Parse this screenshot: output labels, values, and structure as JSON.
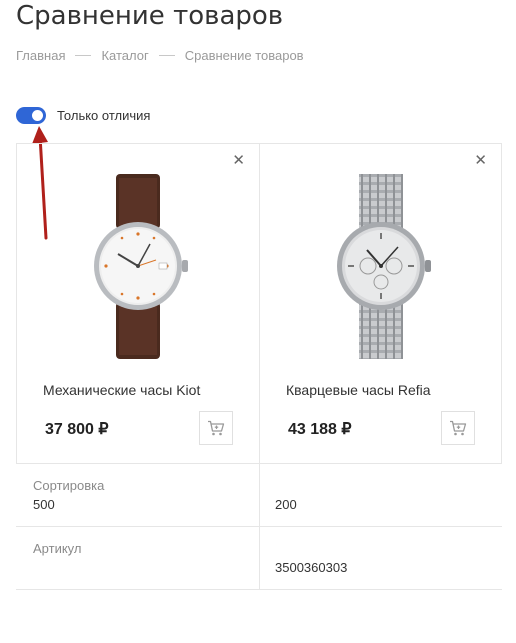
{
  "page": {
    "title": "Сравнение товаров"
  },
  "breadcrumb": [
    "Главная",
    "Каталог",
    "Сравнение товаров"
  ],
  "toggle": {
    "label": "Только отличия",
    "checked": true,
    "accent": "#2f66d6"
  },
  "annotation": {
    "arrow_color": "#b0201b"
  },
  "products": [
    {
      "name": "Механические часы Kiot",
      "price": "37 800 ₽",
      "remove_icon": "close-icon",
      "cart_icon": "cart-icon"
    },
    {
      "name": "Кварцевые часы Refia",
      "price": "43 188 ₽",
      "remove_icon": "close-icon",
      "cart_icon": "cart-icon"
    }
  ],
  "properties": [
    {
      "label": "Сортировка",
      "values": [
        "500",
        "200"
      ]
    },
    {
      "label": "Артикул",
      "values": [
        "",
        "3500360303"
      ]
    }
  ]
}
